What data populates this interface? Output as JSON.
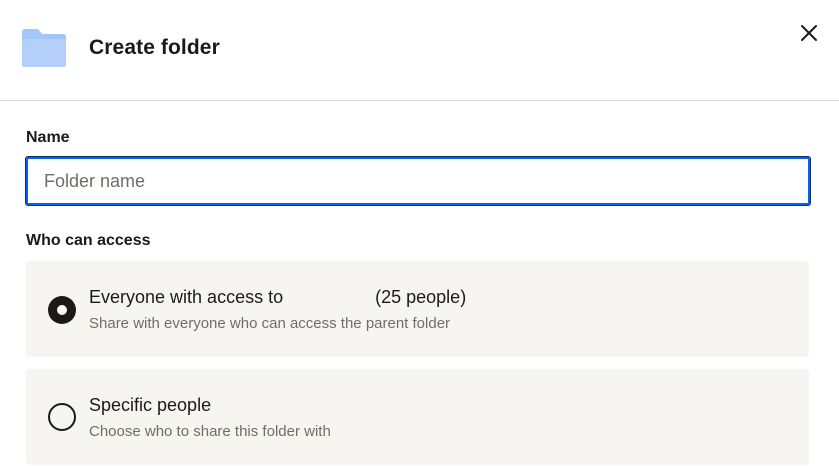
{
  "dialog": {
    "title": "Create folder",
    "folder_icon": "folder-icon",
    "close_icon": "close-icon",
    "colors": {
      "accent": "#0061fe",
      "folder": "#a3c5f8",
      "text": "#1e1919",
      "muted": "#736c64",
      "option_bg": "#f7f5f2"
    }
  },
  "name_field": {
    "label": "Name",
    "placeholder": "Folder name",
    "value": ""
  },
  "access": {
    "label": "Who can access",
    "options": [
      {
        "title_prefix": "Everyone with access to",
        "title_suffix": "(25 people)",
        "subtitle": "Share with everyone who can access the parent folder",
        "selected": true
      },
      {
        "title": "Specific people",
        "subtitle": "Choose who to share this folder with",
        "selected": false
      }
    ]
  }
}
